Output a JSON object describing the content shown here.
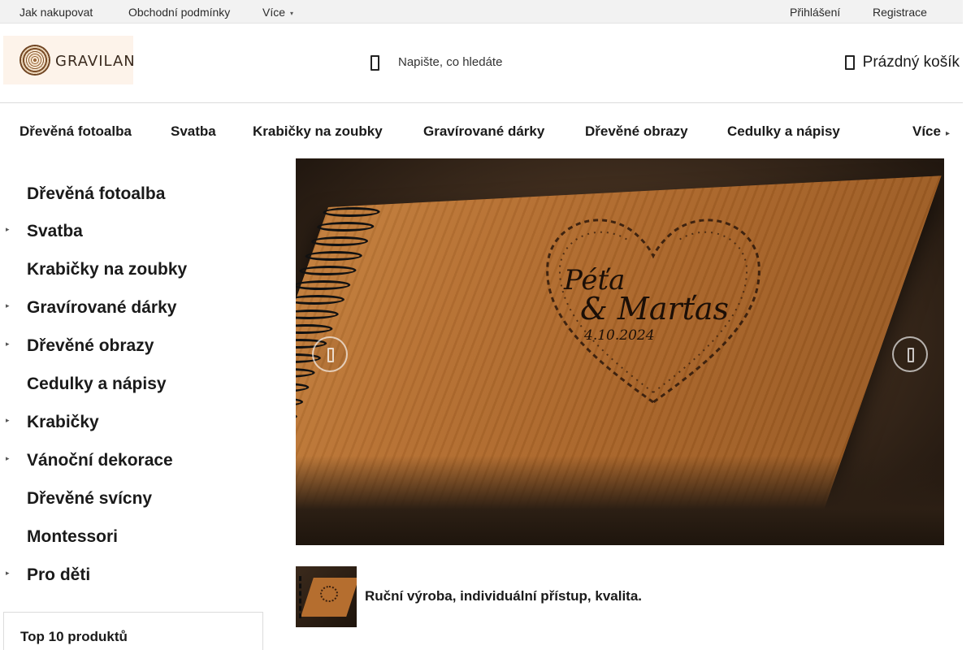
{
  "topbar": {
    "links": [
      "Jak nakupovat",
      "Obchodní podmínky"
    ],
    "more_label": "Více",
    "login": "Přihlášení",
    "register": "Registrace"
  },
  "header": {
    "logo_text": "GRAVILAN",
    "search_placeholder": "Napište, co hledáte",
    "cart_label": "Prázdný košík"
  },
  "main_nav": {
    "items": [
      "Dřevěná fotoalba",
      "Svatba",
      "Krabičky na zoubky",
      "Gravírované dárky",
      "Dřevěné obrazy",
      "Cedulky a nápisy"
    ],
    "more_label": "Více"
  },
  "sidebar": {
    "items": [
      {
        "label": "Dřevěná fotoalba",
        "expandable": false
      },
      {
        "label": "Svatba",
        "expandable": true
      },
      {
        "label": "Krabičky na zoubky",
        "expandable": false
      },
      {
        "label": "Gravírované dárky",
        "expandable": true
      },
      {
        "label": "Dřevěné obrazy",
        "expandable": true
      },
      {
        "label": "Cedulky a nápisy",
        "expandable": false
      },
      {
        "label": "Krabičky",
        "expandable": true
      },
      {
        "label": "Vánoční dekorace",
        "expandable": true
      },
      {
        "label": "Dřevěné svícny",
        "expandable": false
      },
      {
        "label": "Montessori",
        "expandable": false
      },
      {
        "label": "Pro děti",
        "expandable": true
      }
    ],
    "top_products_title": "Top 10 produktů"
  },
  "slider": {
    "engraving_names_1": "Péťa",
    "engraving_names_2": "& Marťas",
    "engraving_date": "4.10.2024"
  },
  "caption": {
    "text": "Ruční výroba, individuální přístup, kvalita."
  },
  "icons": {
    "search": "search-icon",
    "cart": "cart-icon",
    "prev": "arrow-left-icon",
    "next": "arrow-right-icon",
    "expand": "chevron-right-icon",
    "dropdown": "chevron-down-icon"
  }
}
